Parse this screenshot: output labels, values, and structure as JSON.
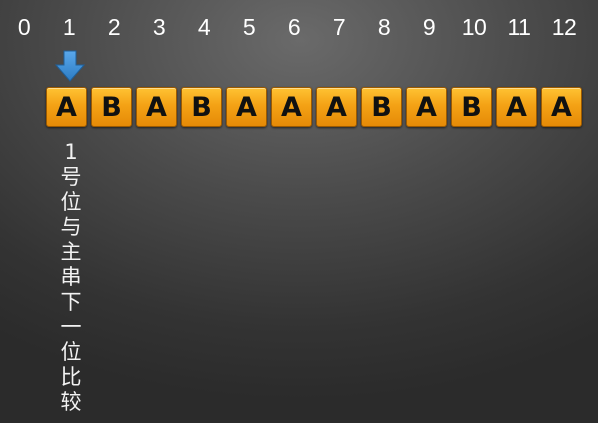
{
  "indices": [
    "0",
    "1",
    "2",
    "3",
    "4",
    "5",
    "6",
    "7",
    "8",
    "9",
    "10",
    "11",
    "12"
  ],
  "pointer": {
    "icon": "down-arrow-icon",
    "color": "#3b8fd6",
    "target_index": 1
  },
  "tiles": [
    "A",
    "B",
    "A",
    "B",
    "A",
    "A",
    "A",
    "B",
    "A",
    "B",
    "A",
    "A"
  ],
  "tile_colors": {
    "fill_top": "#ffc233",
    "fill_bottom": "#e58a07",
    "text": "#111111"
  },
  "caption": {
    "chars": [
      "1",
      "号",
      "位",
      "与",
      "主",
      "串",
      "下",
      "一",
      "位",
      "比",
      "较"
    ]
  }
}
